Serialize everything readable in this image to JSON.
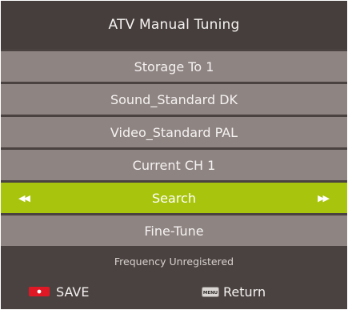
{
  "header": {
    "title": "ATV Manual Tuning"
  },
  "menu": {
    "items": [
      {
        "label": "Storage To 1",
        "selected": false
      },
      {
        "label": "Sound_Standard DK",
        "selected": false
      },
      {
        "label": "Video_Standard PAL",
        "selected": false
      },
      {
        "label": "Current CH 1",
        "selected": false
      },
      {
        "label": "Search",
        "selected": true,
        "left_arrow": "◀◀",
        "right_arrow": "▶▶"
      },
      {
        "label": "Fine-Tune",
        "selected": false
      }
    ]
  },
  "status": {
    "text": "Frequency Unregistered"
  },
  "footer": {
    "save_label": "SAVE",
    "save_icon": "red-button-icon",
    "return_label": "Return",
    "return_icon": "menu-key-icon",
    "menu_key_text": "MENU"
  },
  "colors": {
    "background": "#4a4240",
    "row": "#8e8482",
    "selected_row": "#a9c40c",
    "save_red": "#e01825"
  }
}
